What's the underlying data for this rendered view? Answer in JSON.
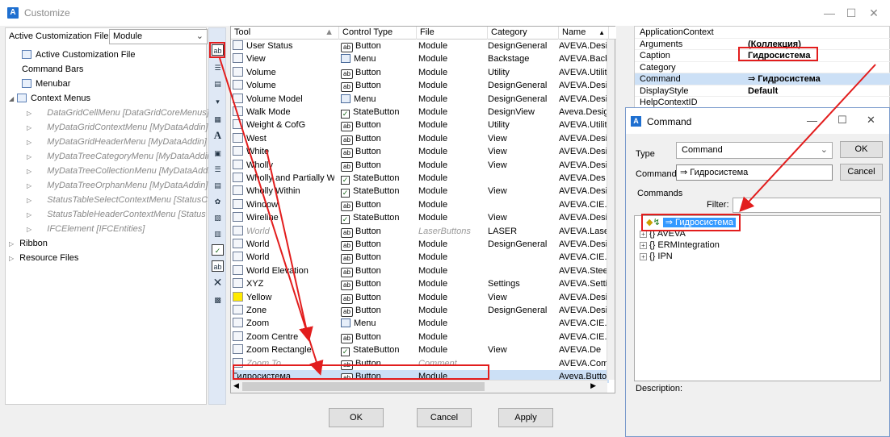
{
  "window": {
    "title": "Customize",
    "app_icon": "A",
    "min": "—",
    "max": "☐",
    "close": "✕"
  },
  "left": {
    "acf_label": "Active Customization File",
    "acf_value": "Module",
    "tree": [
      {
        "label": "Active Customization File",
        "gray": false
      },
      {
        "label": "Command Bars",
        "gray": false
      },
      {
        "label": "Menubar",
        "gray": false
      },
      {
        "label": "Context Menus",
        "gray": false
      },
      {
        "label": "DataGridCellMenu [DataGridCoreMenus]",
        "gray": true
      },
      {
        "label": "MyDataGridContextMenu [MyDataAddin]",
        "gray": true
      },
      {
        "label": "MyDataGridHeaderMenu [MyDataAddin]",
        "gray": true
      },
      {
        "label": "MyDataTreeCategoryMenu [MyDataAddin",
        "gray": true
      },
      {
        "label": "MyDataTreeCollectionMenu [MyDataAddi",
        "gray": true
      },
      {
        "label": "MyDataTreeOrphanMenu [MyDataAddin]",
        "gray": true
      },
      {
        "label": "StatusTableSelectContextMenu [StatusC",
        "gray": true
      },
      {
        "label": "StatusTableHeaderContextMenu [Status",
        "gray": true
      },
      {
        "label": "IFCElement [IFCEntities]",
        "gray": true
      },
      {
        "label": "Ribbon",
        "gray": false
      },
      {
        "label": "Resource Files",
        "gray": false
      }
    ]
  },
  "grid": {
    "headers": [
      "Tool",
      "Control Type",
      "File",
      "Category",
      "Name"
    ],
    "rows": [
      {
        "tool": "User Status",
        "ctrl": "Button",
        "file": "Module",
        "cat": "DesignGeneral",
        "name": "AVEVA.Desi"
      },
      {
        "tool": "View",
        "ctrl": "Menu",
        "file": "Module",
        "cat": "Backstage",
        "name": "AVEVA.Back"
      },
      {
        "tool": "Volume",
        "ctrl": "Button",
        "file": "Module",
        "cat": "Utility",
        "name": "AVEVA.Utilit"
      },
      {
        "tool": "Volume",
        "ctrl": "Button",
        "file": "Module",
        "cat": "DesignGeneral",
        "name": "AVEVA.Desi"
      },
      {
        "tool": "Volume Model",
        "ctrl": "Menu",
        "file": "Module",
        "cat": "DesignGeneral",
        "name": "AVEVA.Desi"
      },
      {
        "tool": "Walk Mode",
        "ctrl": "StateButton",
        "file": "Module",
        "cat": "DesignView",
        "name": "Aveva.Desig"
      },
      {
        "tool": "Weight & CofG",
        "ctrl": "Button",
        "file": "Module",
        "cat": "Utility",
        "name": "AVEVA.Utilit"
      },
      {
        "tool": "West",
        "ctrl": "Button",
        "file": "Module",
        "cat": "View",
        "name": "AVEVA.Desi"
      },
      {
        "tool": "White",
        "ctrl": "Button",
        "file": "Module",
        "cat": "View",
        "name": "AVEVA.Desi"
      },
      {
        "tool": "Wholly",
        "ctrl": "Button",
        "file": "Module",
        "cat": "View",
        "name": "AVEVA.Desi"
      },
      {
        "tool": "Wholly and Partially Wit..",
        "ctrl": "StateButton",
        "file": "Module",
        "cat": "",
        "name": "AVEVA.Des"
      },
      {
        "tool": "Wholly Within",
        "ctrl": "StateButton",
        "file": "Module",
        "cat": "View",
        "name": "AVEVA.Desi"
      },
      {
        "tool": "Window",
        "ctrl": "Button",
        "file": "Module",
        "cat": "",
        "name": "AVEVA.CIE."
      },
      {
        "tool": "Wireline",
        "ctrl": "StateButton",
        "file": "Module",
        "cat": "View",
        "name": "AVEVA.Desi"
      },
      {
        "tool": "World",
        "ctrl": "Button",
        "file": "LaserButtons",
        "cat": "LASER",
        "name": "AVEVA.Lase",
        "gray": true
      },
      {
        "tool": "World",
        "ctrl": "Button",
        "file": "Module",
        "cat": "DesignGeneral",
        "name": "AVEVA.Desi"
      },
      {
        "tool": "World",
        "ctrl": "Button",
        "file": "Module",
        "cat": "",
        "name": "AVEVA.CIE."
      },
      {
        "tool": "World Elevation",
        "ctrl": "Button",
        "file": "Module",
        "cat": "",
        "name": "AVEVA.Stee"
      },
      {
        "tool": "XYZ",
        "ctrl": "Button",
        "file": "Module",
        "cat": "Settings",
        "name": "AVEVA.Setti"
      },
      {
        "tool": "Yellow",
        "ctrl": "Button",
        "file": "Module",
        "cat": "View",
        "name": "AVEVA.Desi"
      },
      {
        "tool": "Zone",
        "ctrl": "Button",
        "file": "Module",
        "cat": "DesignGeneral",
        "name": "AVEVA.Desi"
      },
      {
        "tool": "Zoom",
        "ctrl": "Menu",
        "file": "Module",
        "cat": "",
        "name": "AVEVA.CIE."
      },
      {
        "tool": "Zoom Centre",
        "ctrl": "Button",
        "file": "Module",
        "cat": "",
        "name": "AVEVA.CIE."
      },
      {
        "tool": "Zoom Rectangle",
        "ctrl": "StateButton",
        "file": "Module",
        "cat": "View",
        "name": "AVEVA.De"
      },
      {
        "tool": "Zoom To",
        "ctrl": "Button",
        "file": "Comment",
        "cat": "",
        "name": "AVEVA.Com",
        "gray": true
      },
      {
        "tool": "Гидросистема",
        "ctrl": "Button",
        "file": "Module",
        "cat": "",
        "name": "Aveva.Butto",
        "selected": true
      }
    ]
  },
  "buttons": {
    "ok": "OK",
    "cancel": "Cancel",
    "apply": "Apply"
  },
  "props": [
    {
      "key": "ApplicationContext",
      "val": ""
    },
    {
      "key": "Arguments",
      "val": "(Коллекция)"
    },
    {
      "key": "Caption",
      "val": "Гидросистема"
    },
    {
      "key": "Category",
      "val": ""
    },
    {
      "key": "Command",
      "val": "⇒ Гидросистема",
      "selected": true
    },
    {
      "key": "DisplayStyle",
      "val": "Default"
    },
    {
      "key": "HelpContextID",
      "val": ""
    }
  ],
  "command_dialog": {
    "title": "Command",
    "type_label": "Type",
    "type_value": "Command",
    "command_label": "Command",
    "command_value": "⇒ Гидросистема",
    "ok": "OK",
    "cancel": "Cancel",
    "commands_label": "Commands",
    "filter_label": "Filter:",
    "tree": [
      {
        "label": "⇒ Гидросистема",
        "selected": true
      },
      {
        "label": "{} AVEVA"
      },
      {
        "label": "{} ERMIntegration"
      },
      {
        "label": "{} IPN"
      }
    ],
    "description_label": "Description:"
  }
}
